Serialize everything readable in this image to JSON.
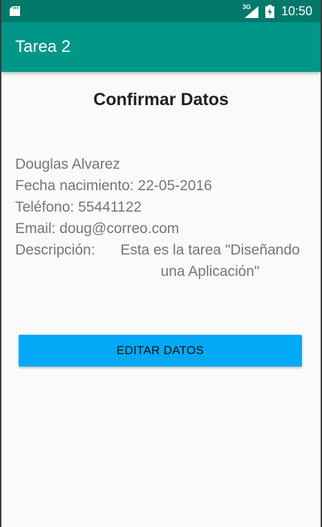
{
  "status_bar": {
    "network": "3G",
    "time": "10:50",
    "icons": [
      "sd-card-icon",
      "signal-icon",
      "battery-charging-icon"
    ]
  },
  "app_bar": {
    "title": "Tarea 2"
  },
  "screen": {
    "heading": "Confirmar Datos",
    "name": "Douglas Alvarez",
    "birth_date": "Fecha nacimiento: 22-05-2016",
    "phone": "Teléfono: 55441122",
    "email": "Email: doug@correo.com",
    "description_label": "Descripción:",
    "description_value": "Esta es la tarea \"Diseñando una Aplicación\"",
    "edit_button": "EDITAR DATOS"
  },
  "colors": {
    "status_bar": "#00796b",
    "app_bar": "#009688",
    "button": "#03a9f4",
    "background": "#fafafa",
    "text_secondary": "#757575"
  }
}
